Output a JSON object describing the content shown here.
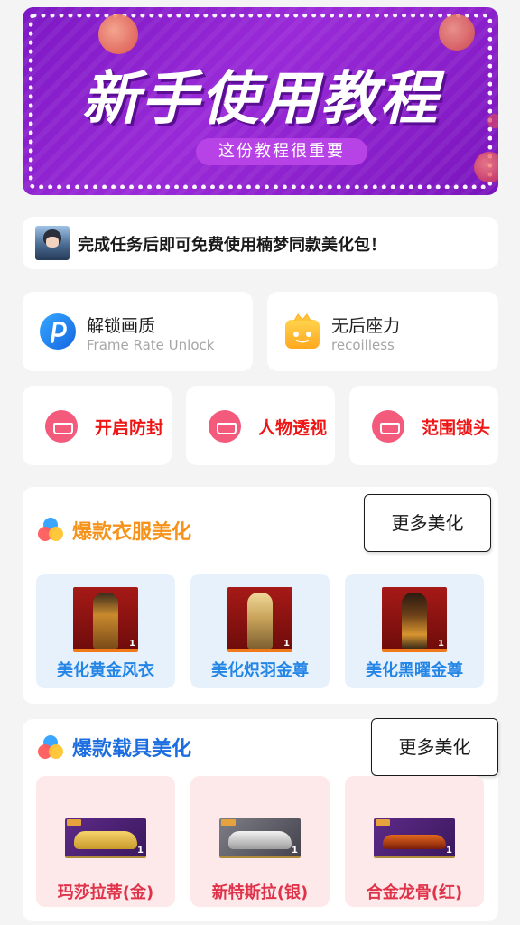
{
  "banner": {
    "title": "新手使用教程",
    "subtitle": "这份教程很重要"
  },
  "notice": {
    "text": "完成任务后即可免费使用楠梦同款美化包！"
  },
  "features": [
    {
      "title": "解锁画质",
      "subtitle": "Frame Rate Unlock",
      "icon": "p-app-icon"
    },
    {
      "title": "无后座力",
      "subtitle": "recoilless",
      "icon": "gift-box-icon"
    }
  ],
  "toggles": [
    {
      "label": "开启防封",
      "icon": "crown-icon"
    },
    {
      "label": "人物透视",
      "icon": "crown-icon"
    },
    {
      "label": "范围锁头",
      "icon": "crown-icon"
    }
  ],
  "clothing": {
    "title": "爆款衣服美化",
    "more_label": "更多美化",
    "items": [
      {
        "name": "美化黄金风衣",
        "count": "1"
      },
      {
        "name": "美化炽羽金尊",
        "count": "1"
      },
      {
        "name": "美化黑曜金尊",
        "count": "1"
      }
    ]
  },
  "vehicles": {
    "title": "爆款载具美化",
    "more_label": "更多美化",
    "items": [
      {
        "name": "玛莎拉蒂(金)",
        "count": "1"
      },
      {
        "name": "新特斯拉(银)",
        "count": "1"
      },
      {
        "name": "合金龙骨(红)",
        "count": "1"
      }
    ]
  },
  "colors": {
    "banner": "#8a1fcf",
    "toggle_text": "#ee1515",
    "clothing_title": "#f5931b",
    "vehicle_title": "#1c6ee0",
    "clothing_name": "#2385e6",
    "vehicle_name": "#e0334a"
  }
}
